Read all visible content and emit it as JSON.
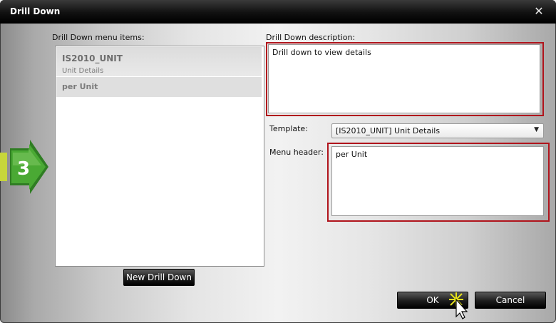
{
  "dialog": {
    "title": "Drill Down",
    "close_glyph": "✕"
  },
  "left_panel": {
    "label": "Drill Down menu items:",
    "items": [
      {
        "title": "IS2010_UNIT",
        "subtitle": "Unit Details"
      },
      {
        "title": "per Unit"
      }
    ],
    "new_button_label": "New Drill Down"
  },
  "right_panel": {
    "description_label": "Drill Down description:",
    "description_value": "Drill down to view details",
    "template_label": "Template:",
    "template_value": "[IS2010_UNIT] Unit Details",
    "menu_header_label": "Menu header:",
    "menu_header_value": "per Unit"
  },
  "footer": {
    "ok_label": "OK",
    "cancel_label": "Cancel"
  },
  "step_badge": {
    "number": "3",
    "icon": "green-arrow-step-icon"
  },
  "colors": {
    "highlight": "#b0141c",
    "titlebar": "#111111",
    "badge_green": "#3f9a2a"
  }
}
